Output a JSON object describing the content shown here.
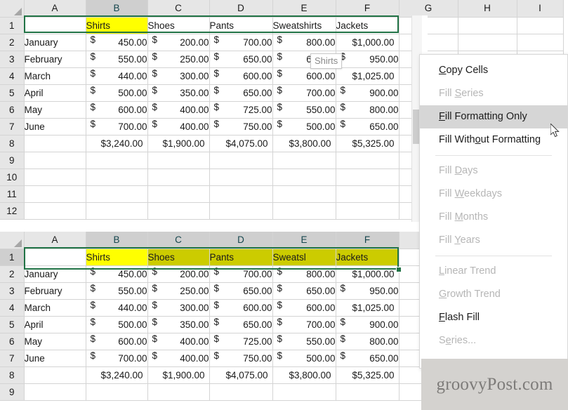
{
  "app": {
    "name": "Microsoft Excel",
    "theme_accent": "#217346",
    "highlight_fill": "#ffff00",
    "selected_fill": "#cccc00",
    "header_bg": "#e6e6e6",
    "header_text": "#1f4e55",
    "menu_highlight": "#d6d6d6"
  },
  "top_pane": {
    "columns": [
      "A",
      "B",
      "C",
      "D",
      "E",
      "F",
      "G",
      "H",
      "I"
    ],
    "row_numbers": [
      "1",
      "2",
      "3",
      "4",
      "5",
      "6",
      "7",
      "8",
      "9",
      "10",
      "11",
      "12"
    ],
    "header_row": {
      "a": "",
      "b": "Shirts",
      "c": "Shoes",
      "d": "Pants",
      "e": "Sweatshirts",
      "f": "Jackets"
    },
    "rows": [
      {
        "n": "2",
        "month": "January",
        "b": "450.00",
        "c": "200.00",
        "d": "700.00",
        "e": "800.00",
        "f": "$1,000.00"
      },
      {
        "n": "3",
        "month": "February",
        "b": "550.00",
        "c": "250.00",
        "d": "650.00",
        "e": "650.00",
        "f": "$  950.00"
      },
      {
        "n": "4",
        "month": "March",
        "b": "440.00",
        "c": "300.00",
        "d": "600.00",
        "e": "600.00",
        "f": "$1,025.00"
      },
      {
        "n": "5",
        "month": "April",
        "b": "500.00",
        "c": "350.00",
        "d": "650.00",
        "e": "700.00",
        "f": "$  900.00"
      },
      {
        "n": "6",
        "month": "May",
        "b": "600.00",
        "c": "400.00",
        "d": "725.00",
        "e": "550.00",
        "f": "$  800.00"
      },
      {
        "n": "7",
        "month": "June",
        "b": "700.00",
        "c": "400.00",
        "d": "750.00",
        "e": "500.00",
        "f": "$  650.00"
      }
    ],
    "totals": {
      "n": "8",
      "month": "",
      "b": "$3,240.00",
      "c": "$1,900.00",
      "d": "$4,075.00",
      "e": "$3,800.00",
      "f": "$5,325.00"
    },
    "currency_symbol": "$",
    "empty_row_numbers": [
      "9",
      "10",
      "11",
      "12"
    ]
  },
  "bottom_pane": {
    "columns": [
      "A",
      "B",
      "C",
      "D",
      "E",
      "F"
    ],
    "header_row": {
      "a": "",
      "b": "Shirts",
      "c": "Shoes",
      "d": "Pants",
      "e": "Sweatsl",
      "f": "Jackets"
    },
    "rows": [
      {
        "n": "2",
        "month": "January",
        "b": "450.00",
        "c": "200.00",
        "d": "700.00",
        "e": "800.00",
        "f": "$1,000.00"
      },
      {
        "n": "3",
        "month": "February",
        "b": "550.00",
        "c": "250.00",
        "d": "650.00",
        "e": "650.00",
        "f": "$  950.00"
      },
      {
        "n": "4",
        "month": "March",
        "b": "440.00",
        "c": "300.00",
        "d": "600.00",
        "e": "600.00",
        "f": "$1,025.00"
      },
      {
        "n": "5",
        "month": "April",
        "b": "500.00",
        "c": "350.00",
        "d": "650.00",
        "e": "700.00",
        "f": "$  900.00"
      },
      {
        "n": "6",
        "month": "May",
        "b": "600.00",
        "c": "400.00",
        "d": "725.00",
        "e": "550.00",
        "f": "$  800.00"
      },
      {
        "n": "7",
        "month": "June",
        "b": "700.00",
        "c": "400.00",
        "d": "750.00",
        "e": "500.00",
        "f": "$  650.00"
      }
    ],
    "totals": {
      "n": "8",
      "month": "",
      "b": "$3,240.00",
      "c": "$1,900.00",
      "d": "$4,075.00",
      "e": "$3,800.00",
      "f": "$5,325.00"
    },
    "empty_row_numbers": [
      "9"
    ],
    "row_numbers": [
      "1",
      "2",
      "3",
      "4",
      "5",
      "6",
      "7",
      "8",
      "9"
    ]
  },
  "tooltip": {
    "text": "Shirts"
  },
  "context_menu": {
    "items": [
      {
        "label": "Copy Cells",
        "accel": "C",
        "state": "enabled"
      },
      {
        "label": "Fill Series",
        "accel": "S",
        "state": "disabled"
      },
      {
        "label": "Fill Formatting Only",
        "accel": "F",
        "state": "highlighted"
      },
      {
        "label": "Fill Without Formatting",
        "accel": "o",
        "state": "enabled"
      },
      {
        "separator": true
      },
      {
        "label": "Fill Days",
        "accel": "D",
        "state": "disabled"
      },
      {
        "label": "Fill Weekdays",
        "accel": "W",
        "state": "disabled"
      },
      {
        "label": "Fill Months",
        "accel": "M",
        "state": "disabled"
      },
      {
        "label": "Fill Years",
        "accel": "Y",
        "state": "disabled"
      },
      {
        "separator": true
      },
      {
        "label": "Linear Trend",
        "accel": "L",
        "state": "disabled"
      },
      {
        "label": "Growth Trend",
        "accel": "G",
        "state": "disabled"
      },
      {
        "label": "Flash Fill",
        "accel": "F",
        "state": "enabled"
      },
      {
        "label": "Series...",
        "accel": "e",
        "state": "disabled"
      }
    ]
  },
  "watermark": {
    "text": "groovyPost.com"
  }
}
